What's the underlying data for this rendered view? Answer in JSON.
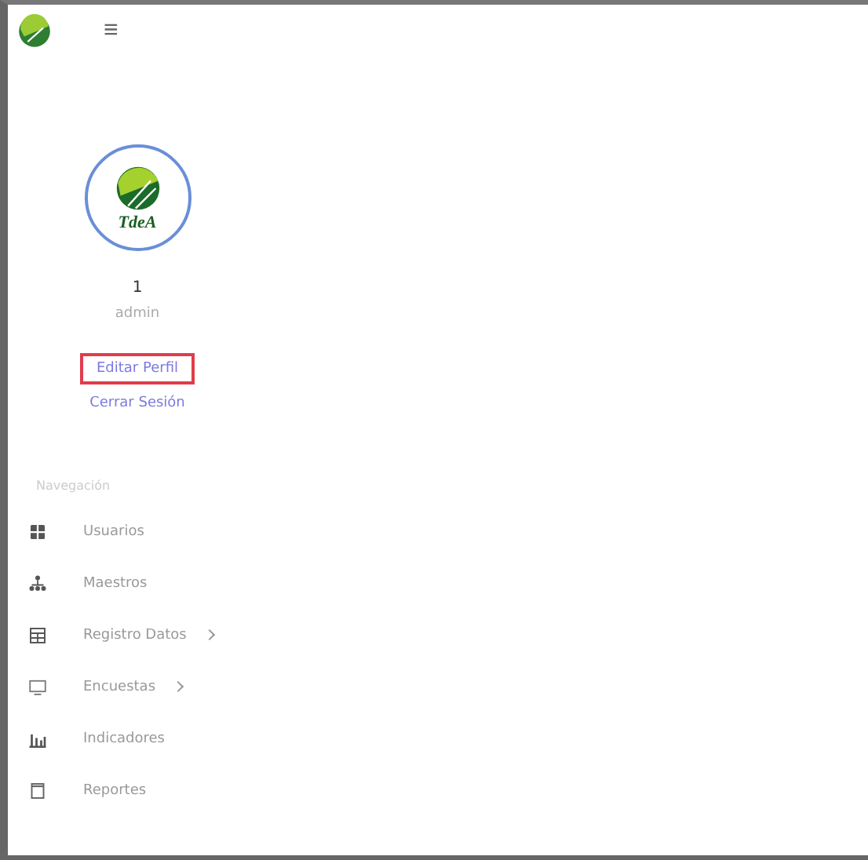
{
  "header": {
    "menu_button": "≡"
  },
  "profile": {
    "logo_text": "TdeA",
    "user_id": "1",
    "role": "admin",
    "links": [
      {
        "label": "Editar Perfil",
        "highlighted": true
      },
      {
        "label": "Cerrar Sesión",
        "highlighted": false
      }
    ]
  },
  "nav": {
    "heading": "Navegación",
    "items": [
      {
        "label": "Usuarios",
        "expandable": false
      },
      {
        "label": "Maestros",
        "expandable": false
      },
      {
        "label": "Registro Datos",
        "expandable": true
      },
      {
        "label": "Encuestas",
        "expandable": true
      },
      {
        "label": "Indicadores",
        "expandable": false
      },
      {
        "label": "Reportes",
        "expandable": false
      }
    ]
  }
}
